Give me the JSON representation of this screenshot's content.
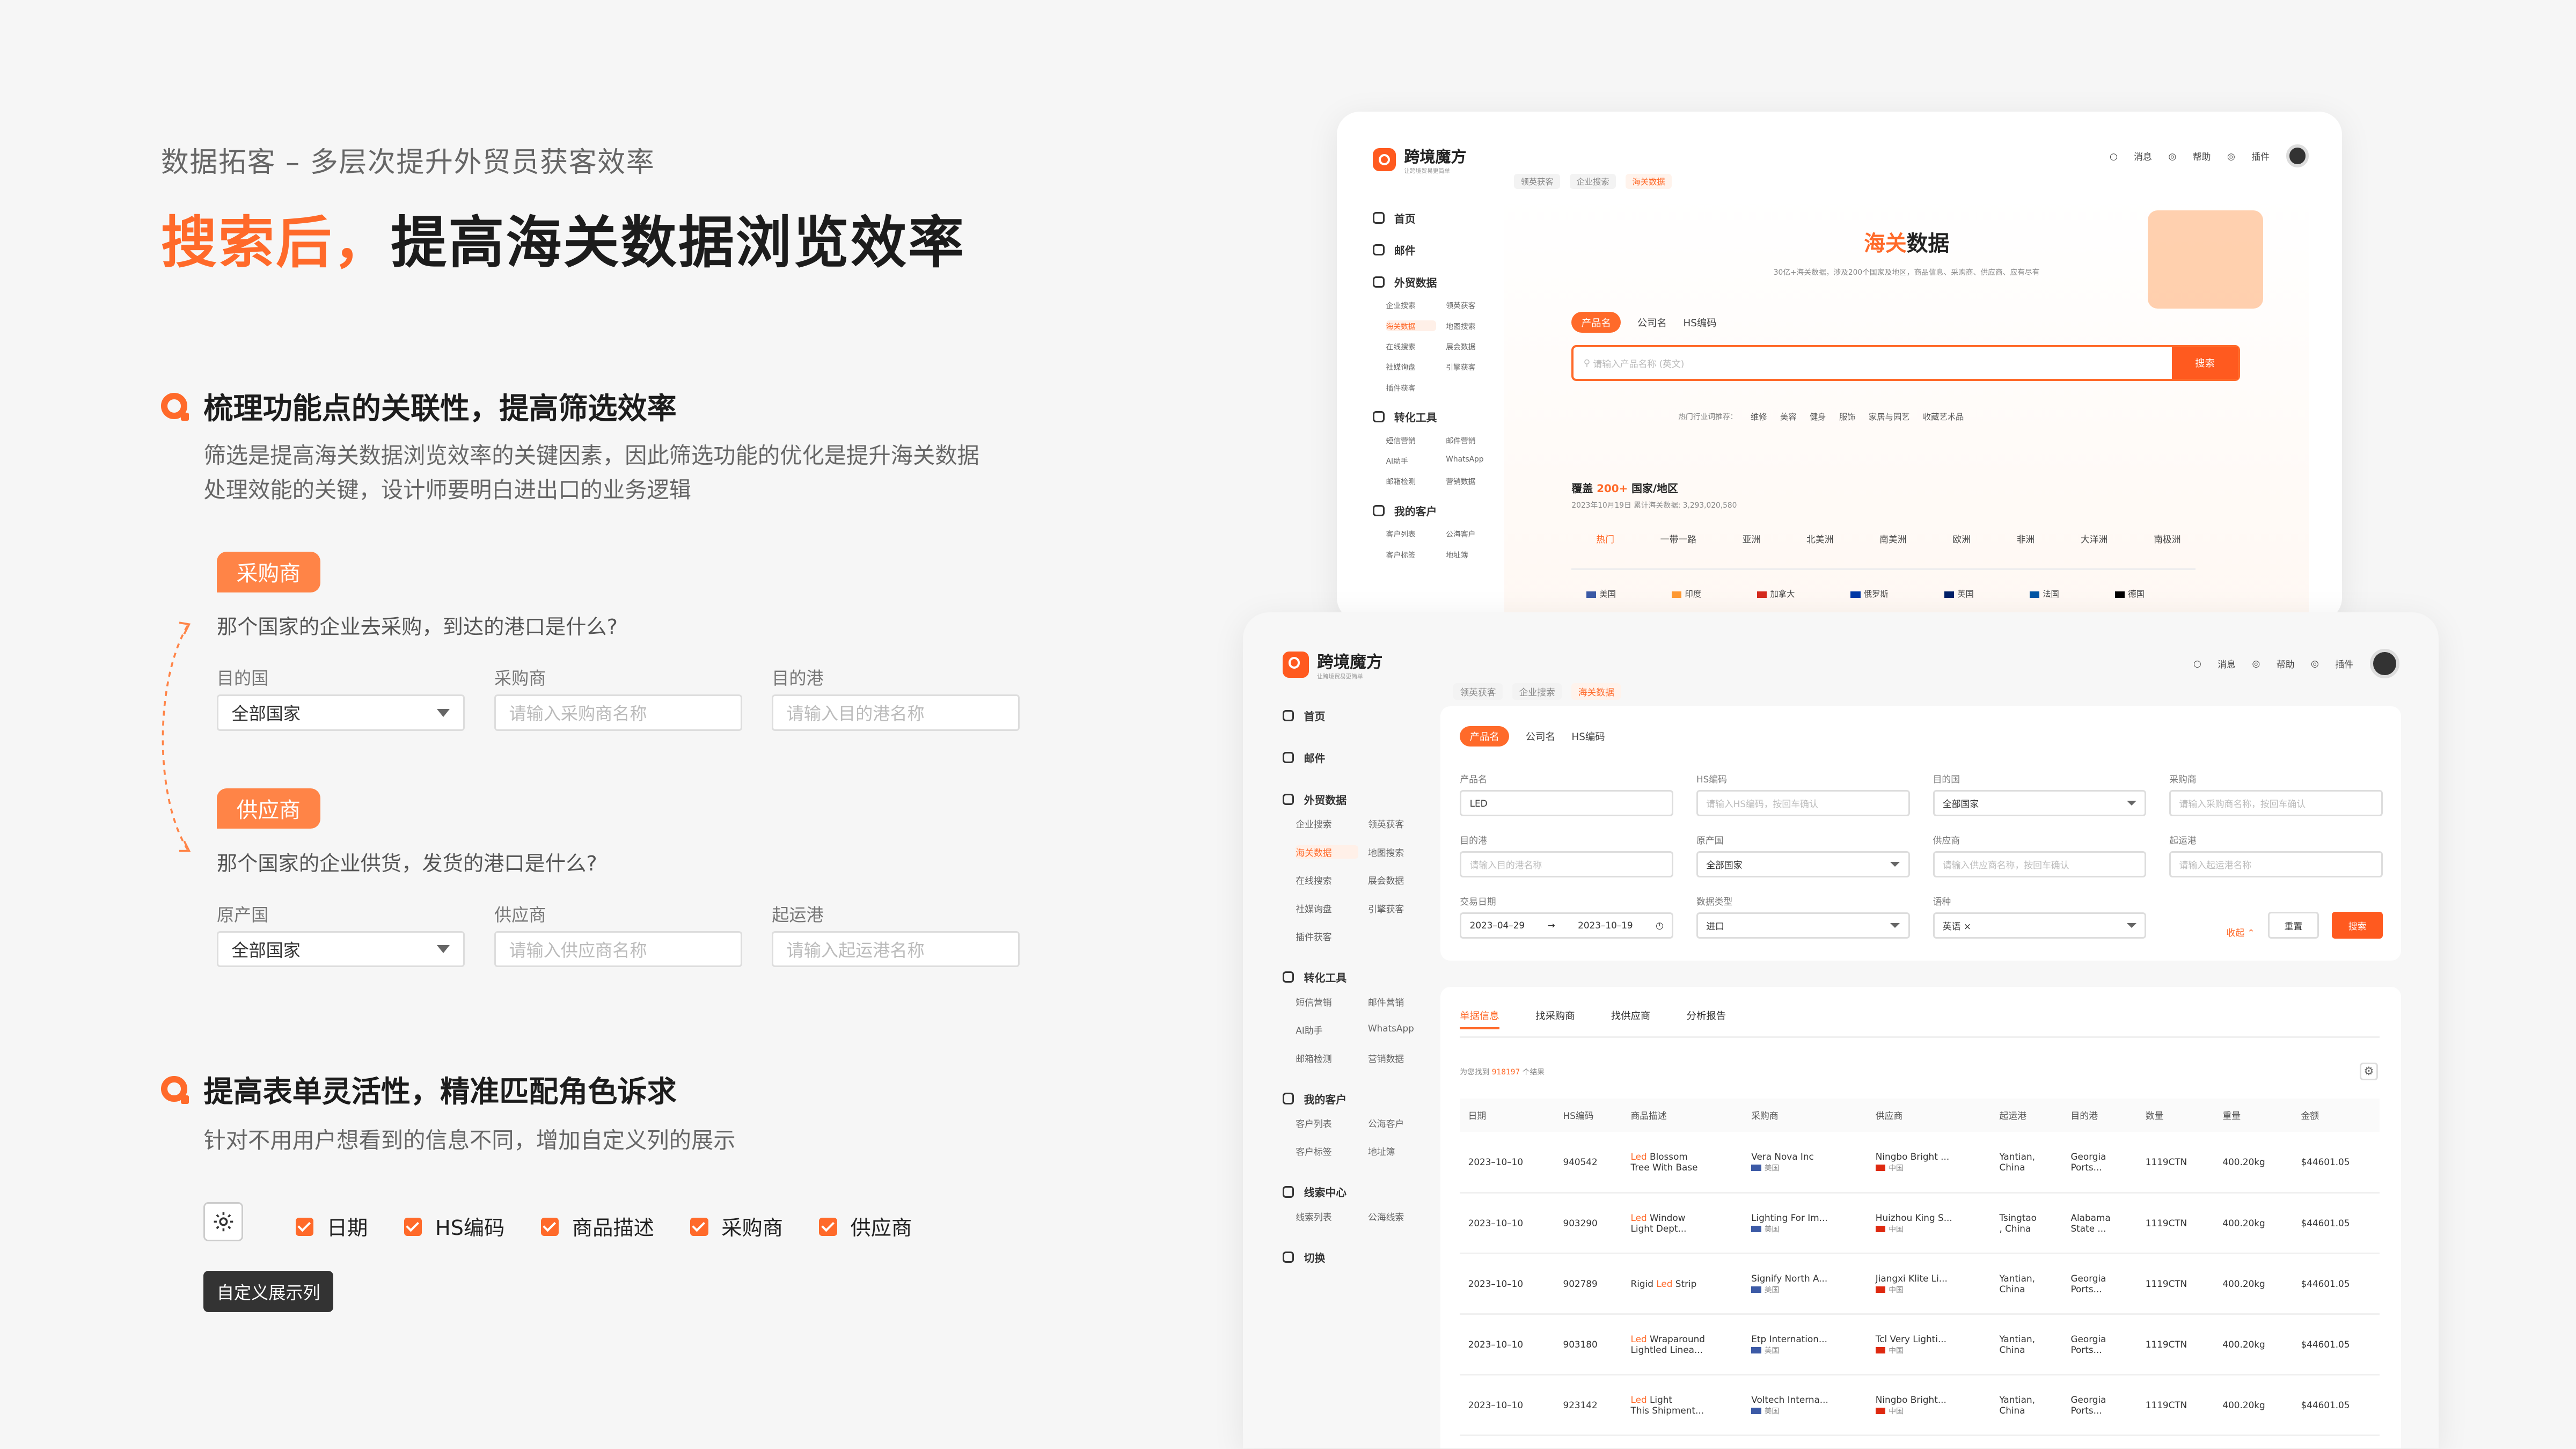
{
  "left": {
    "subtitle": "数据拓客 – 多层次提升外贸员获客效率",
    "title_highlight": "搜索后，",
    "title_rest": "提高海关数据浏览效率",
    "sec1": {
      "title": "梳理功能点的关联性，提高筛选效率",
      "desc1": "筛选是提高海关数据浏览效率的关键因素，因此筛选功能的优化是提升海关数据",
      "desc2": "处理效能的关键，设计师要明白进出口的业务逻辑"
    },
    "buyer": {
      "tag": "采购商",
      "question": "那个国家的企业去采购，到达的港口是什么?",
      "f1_label": "目的国",
      "f1_value": "全部国家",
      "f2_label": "采购商",
      "f2_ph": "请输入采购商名称",
      "f3_label": "目的港",
      "f3_ph": "请输入目的港名称"
    },
    "supplier": {
      "tag": "供应商",
      "question": "那个国家的企业供货，发货的港口是什么?",
      "f1_label": "原产国",
      "f1_value": "全部国家",
      "f2_label": "供应商",
      "f2_ph": "请输入供应商名称",
      "f3_label": "起运港",
      "f3_ph": "请输入起运港名称"
    },
    "sec2": {
      "title": "提高表单灵活性，精准匹配角色诉求",
      "desc": "针对不用用户想看到的信息不同，增加自定义列的展示"
    },
    "columns": [
      "日期",
      "HS编码",
      "商品描述",
      "采购商",
      "供应商"
    ],
    "tooltip": "自定义展示列"
  },
  "app": {
    "name": "跨境魔方",
    "slogan": "让跨境贸易更简单",
    "top": {
      "msg": "消息",
      "help": "帮助",
      "plugin": "插件"
    },
    "nav": {
      "home": "首页",
      "mail": "邮件",
      "trade": "外贸数据",
      "trade_items": [
        "企业搜索",
        "领英获客",
        "海关数据",
        "地图搜索",
        "在线搜索",
        "展会数据",
        "社媒询盘",
        "引擎获客",
        "插件获客"
      ],
      "convert": "转化工具",
      "convert_items": [
        "短信营销",
        "邮件营销",
        "AI助手",
        "WhatsApp",
        "邮箱检测",
        "营销数据"
      ],
      "customer": "我的客户",
      "customer_items": [
        "客户列表",
        "公海客户",
        "客户标签",
        "地址簿"
      ],
      "lead": "线索中心",
      "lead_items": [
        "线索列表",
        "公海线索"
      ],
      "switch": "切换"
    },
    "tabs": [
      "领英获客",
      "企业搜索",
      "海关数据"
    ]
  },
  "back": {
    "hero_a": "海关",
    "hero_b": "数据",
    "hero_desc": "30亿+海关数据，涉及200个国家及地区，商品信息、采购商、供应商、应有尽有",
    "seg": [
      "产品名",
      "公司名",
      "HS编码"
    ],
    "search_ph": "请输入产品名称 (英文)",
    "search_btn": "搜索",
    "hot_label": "热门行业词推荐：",
    "hot": [
      "维修",
      "美容",
      "健身",
      "服饰",
      "家居与园艺",
      "收藏艺术品"
    ],
    "cover_a": "覆盖",
    "cover_num": "200+",
    "cover_b": "国家/地区",
    "cover_sub": "2023年10月19日   累计海关数据: 3,293,020,580",
    "regions": [
      "热门",
      "一带一路",
      "亚洲",
      "北美洲",
      "南美洲",
      "欧洲",
      "非洲",
      "大洋洲",
      "南极洲"
    ],
    "countries": [
      "美国",
      "印度",
      "加拿大",
      "俄罗斯",
      "英国",
      "法国",
      "德国"
    ]
  },
  "front": {
    "seg": [
      "产品名",
      "公司名",
      "HS编码"
    ],
    "filters": [
      {
        "label": "产品名",
        "value": "LED",
        "ph": ""
      },
      {
        "label": "HS编码",
        "value": "",
        "ph": "请输入HS编码，按回车确认"
      },
      {
        "label": "目的国",
        "value": "全部国家",
        "ph": ""
      },
      {
        "label": "采购商",
        "value": "",
        "ph": "请输入采购商名称，按回车确认"
      },
      {
        "label": "目的港",
        "value": "",
        "ph": "请输入目的港名称"
      },
      {
        "label": "原产国",
        "value": "全部国家",
        "ph": ""
      },
      {
        "label": "供应商",
        "value": "",
        "ph": "请输入供应商名称，按回车确认"
      },
      {
        "label": "起运港",
        "value": "",
        "ph": "请输入起运港名称"
      }
    ],
    "date_label": "交易日期",
    "date_from": "2023–04–29",
    "date_to": "2023–10–19",
    "type_label": "数据类型",
    "type_value": "进口",
    "lang_label": "语种",
    "lang_value": "英语",
    "collapse": "收起",
    "reset": "重置",
    "search": "搜索",
    "result_tabs": [
      "单据信息",
      "找采购商",
      "找供应商",
      "分析报告"
    ],
    "found_a": "为您找到",
    "found_num": "918197",
    "found_b": "个结果",
    "headers": [
      "日期",
      "HS编码",
      "商品描述",
      "采购商",
      "供应商",
      "起运港",
      "目的港",
      "数量",
      "重量",
      "金额"
    ],
    "rows": [
      {
        "date": "2023–10–10",
        "hs": "940542",
        "d1": "Led",
        "d2": " Blossom",
        "d3": "Tree With Base",
        "buyer": "Vera Nova Inc",
        "bc": "美国",
        "sup": "Ningbo Bright ...",
        "sc": "中国",
        "p1": "Yantian,",
        "p2": "China",
        "q1": "Georgia",
        "q2": "Ports...",
        "qty": "1119CTN",
        "wt": "400.20kg",
        "amt": "$44601.05"
      },
      {
        "date": "2023–10–10",
        "hs": "903290",
        "d1": "Led",
        "d2": " Window",
        "d3": "Light Dept...",
        "buyer": "Lighting For Im...",
        "bc": "美国",
        "sup": "Huizhou King S...",
        "sc": "中国",
        "p1": "Tsingtao",
        "p2": ", China",
        "q1": "Alabama",
        "q2": "State ...",
        "qty": "1119CTN",
        "wt": "400.20kg",
        "amt": "$44601.05"
      },
      {
        "date": "2023–10–10",
        "hs": "902789",
        "d1": "Rigid ",
        "d2": "Led",
        "d3": " Strip",
        "buyer": "Signify North A...",
        "bc": "美国",
        "sup": "Jiangxi Klite Li...",
        "sc": "中国",
        "p1": "Yantian,",
        "p2": "China",
        "q1": "Georgia",
        "q2": "Ports...",
        "qty": "1119CTN",
        "wt": "400.20kg",
        "amt": "$44601.05"
      },
      {
        "date": "2023–10–10",
        "hs": "903180",
        "d1": "Led",
        "d2": " Wraparound",
        "d3": "Lightled Linea...",
        "buyer": "Etp Internation...",
        "bc": "美国",
        "sup": "Tcl Very Lighti...",
        "sc": "中国",
        "p1": "Yantian,",
        "p2": "China",
        "q1": "Georgia",
        "q2": "Ports...",
        "qty": "1119CTN",
        "wt": "400.20kg",
        "amt": "$44601.05"
      },
      {
        "date": "2023–10–10",
        "hs": "923142",
        "d1": "Led",
        "d2": " Light",
        "d3": "This Shipment...",
        "buyer": "Voltech Interna...",
        "bc": "美国",
        "sup": "Ningbo Bright...",
        "sc": "中国",
        "p1": "Yantian,",
        "p2": "China",
        "q1": "Georgia",
        "q2": "Ports...",
        "qty": "1119CTN",
        "wt": "400.20kg",
        "amt": "$44601.05"
      }
    ]
  },
  "colors": {
    "accent": "#ff6a2a",
    "pill": "#ff8447"
  }
}
